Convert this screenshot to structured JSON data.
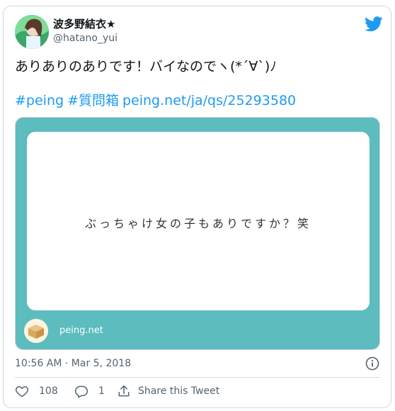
{
  "author": {
    "display_name": "波多野結衣★",
    "handle": "@hatano_yui"
  },
  "tweet": {
    "text": "ありありのありです！バイなのでヽ(*´∀`)ﾉ",
    "links": [
      "#peing",
      "#質問箱",
      "peing.net/ja/qs/25293580"
    ]
  },
  "media_card": {
    "question": "ぶっちゃけ女の子もありですか？笑",
    "brand": "peing.net",
    "background_color": "#5cbcbe"
  },
  "meta": {
    "timestamp": "10:56 AM · Mar 5, 2018"
  },
  "actions": {
    "like_count": "108",
    "reply_count": "1",
    "share_label": "Share this Tweet"
  },
  "colors": {
    "link": "#1d9bf0",
    "secondary_text": "#536471",
    "border": "#cfd9de"
  }
}
